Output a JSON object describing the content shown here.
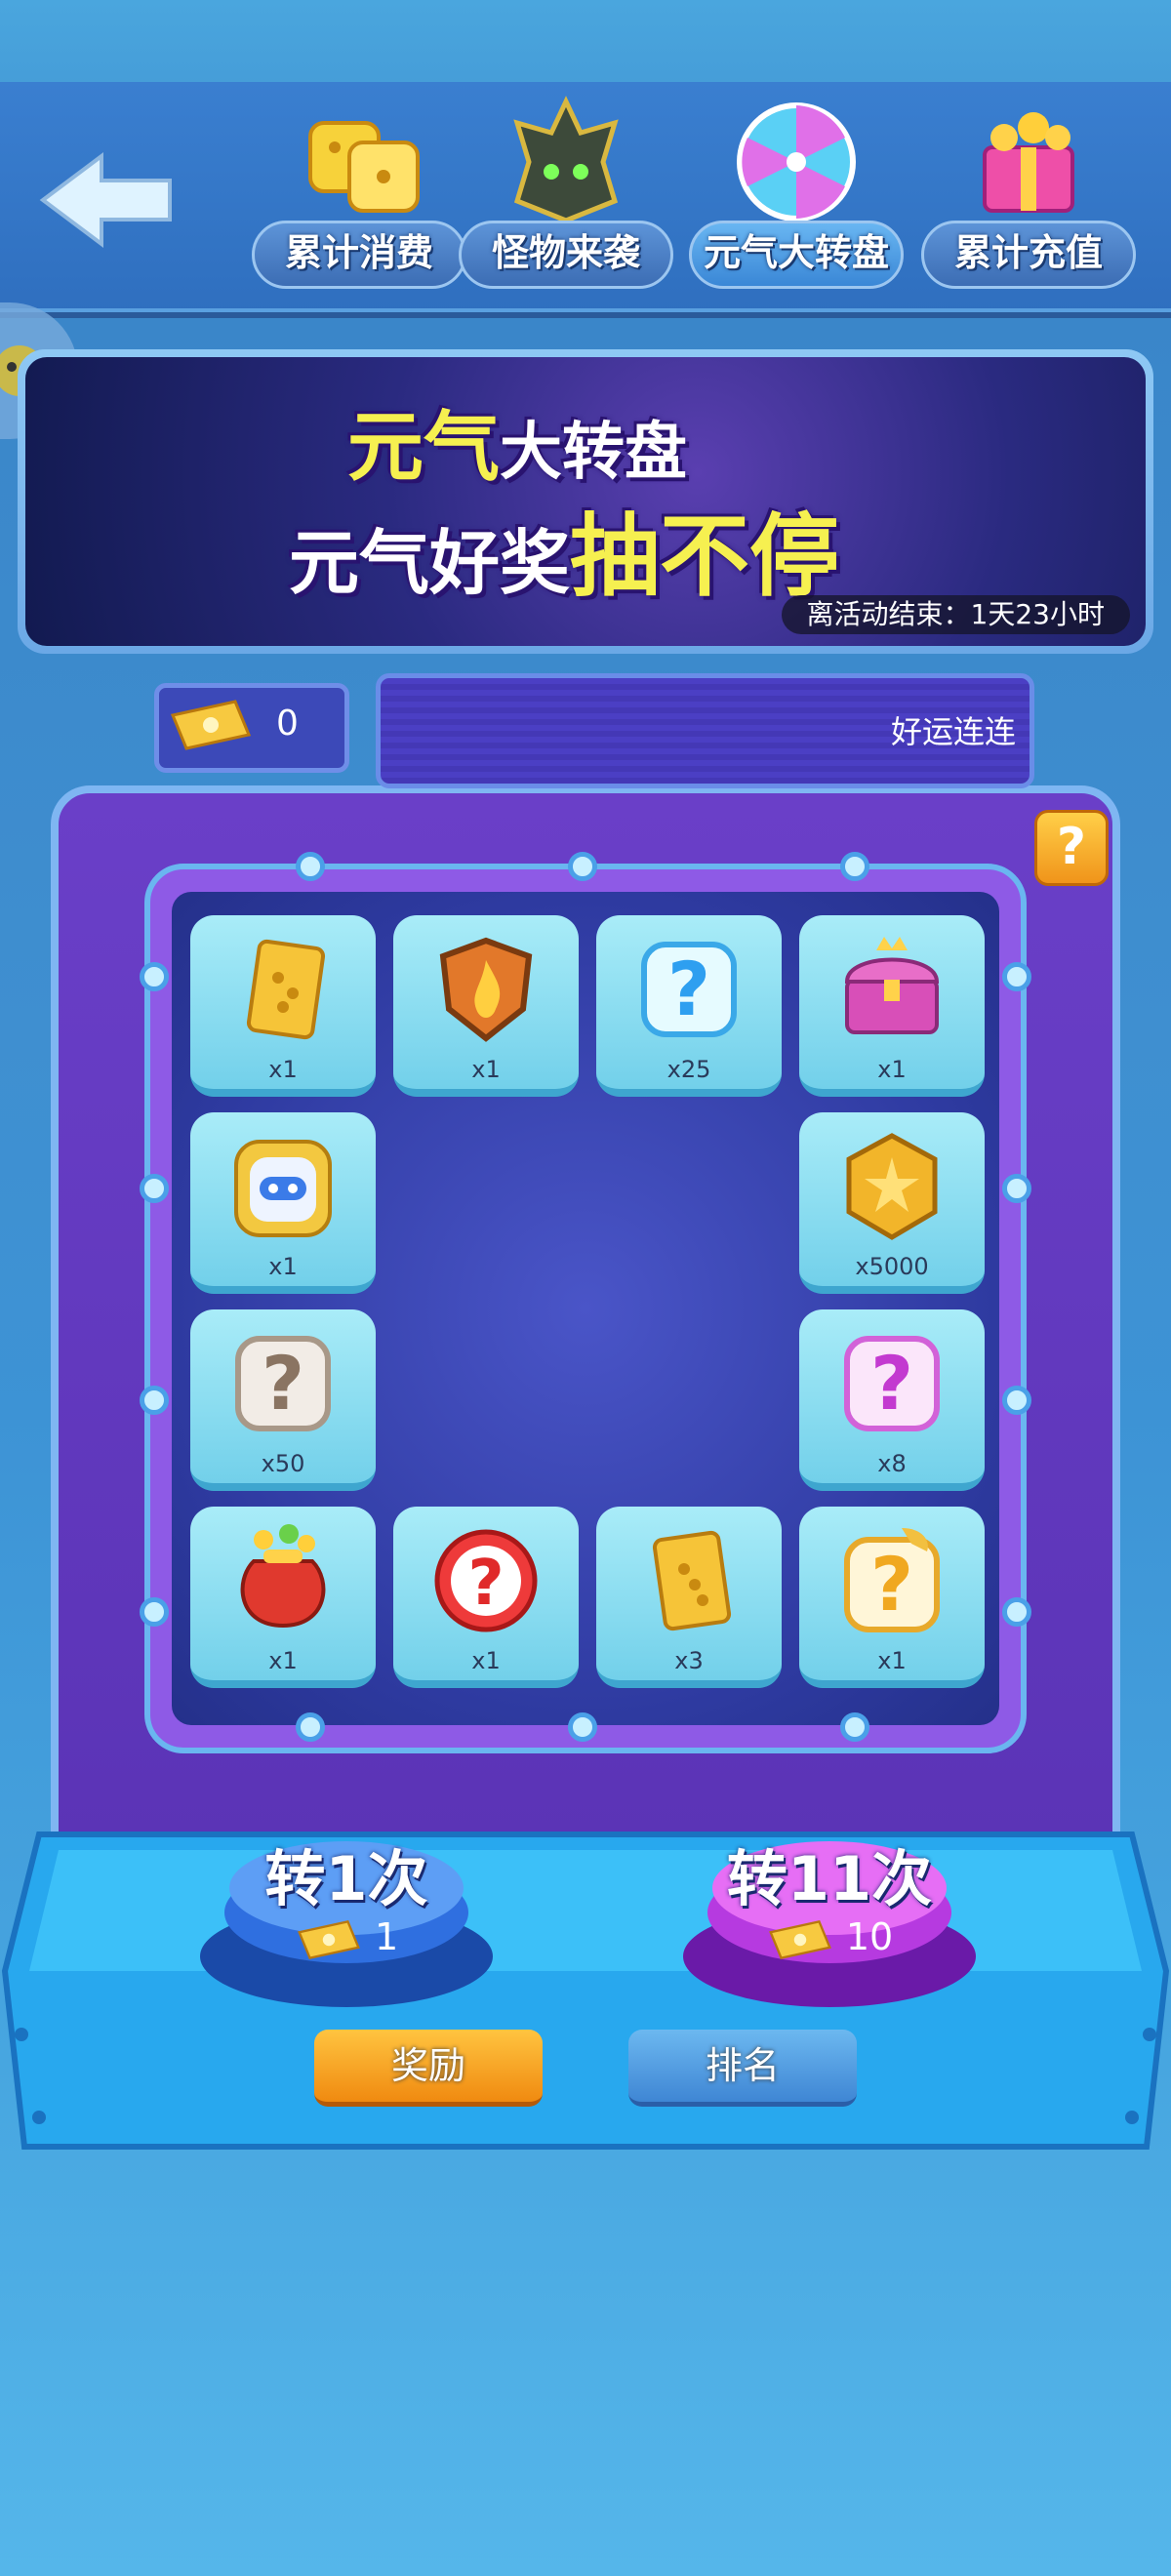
{
  "nav": {
    "tabs": [
      {
        "label": "累计消费",
        "icon": "gold-dice-icon"
      },
      {
        "label": "怪物来袭",
        "icon": "monster-helmet-icon"
      },
      {
        "label": "元气大转盘",
        "icon": "wheel-icon",
        "active": true
      },
      {
        "label": "累计充值",
        "icon": "gift-box-icon"
      }
    ]
  },
  "banner": {
    "title_line1_a": "元气",
    "title_line1_b": "大转盘",
    "title_line2_a": "元气好奖",
    "title_line2_b": "抽不停",
    "countdown": "离活动结束：1天23小时"
  },
  "ticket": {
    "count": "0"
  },
  "marquee": {
    "text": "好运连连"
  },
  "help": {
    "label": "?"
  },
  "prizes": [
    {
      "qty": "x1",
      "icon": "dice-card-icon"
    },
    {
      "qty": "x1",
      "icon": "fire-shield-icon"
    },
    {
      "qty": "x25",
      "icon": "blue-mystery-icon"
    },
    {
      "qty": "x1",
      "icon": "treasure-chest-icon"
    },
    {
      "qty": "x1",
      "icon": "robot-avatar-icon"
    },
    {
      "qty": "x5000",
      "icon": "gold-coin-icon"
    },
    {
      "qty": "x50",
      "icon": "white-mystery-icon"
    },
    {
      "qty": "x8",
      "icon": "pink-mystery-icon"
    },
    {
      "qty": "x1",
      "icon": "lucky-bag-icon"
    },
    {
      "qty": "x1",
      "icon": "red-mystery-icon"
    },
    {
      "qty": "x3",
      "icon": "dice-card-icon"
    },
    {
      "qty": "x1",
      "icon": "gold-mystery-icon"
    }
  ],
  "spin": {
    "one_label": "转1次",
    "one_cost": "1",
    "eleven_label": "转11次",
    "eleven_cost": "10"
  },
  "bottom_tabs": {
    "reward": "奖励",
    "rank": "排名"
  },
  "colors": {
    "accent_gold": "#f6f050",
    "board_purple": "#6a3fc8",
    "cell_cyan": "#8fe0f2"
  }
}
